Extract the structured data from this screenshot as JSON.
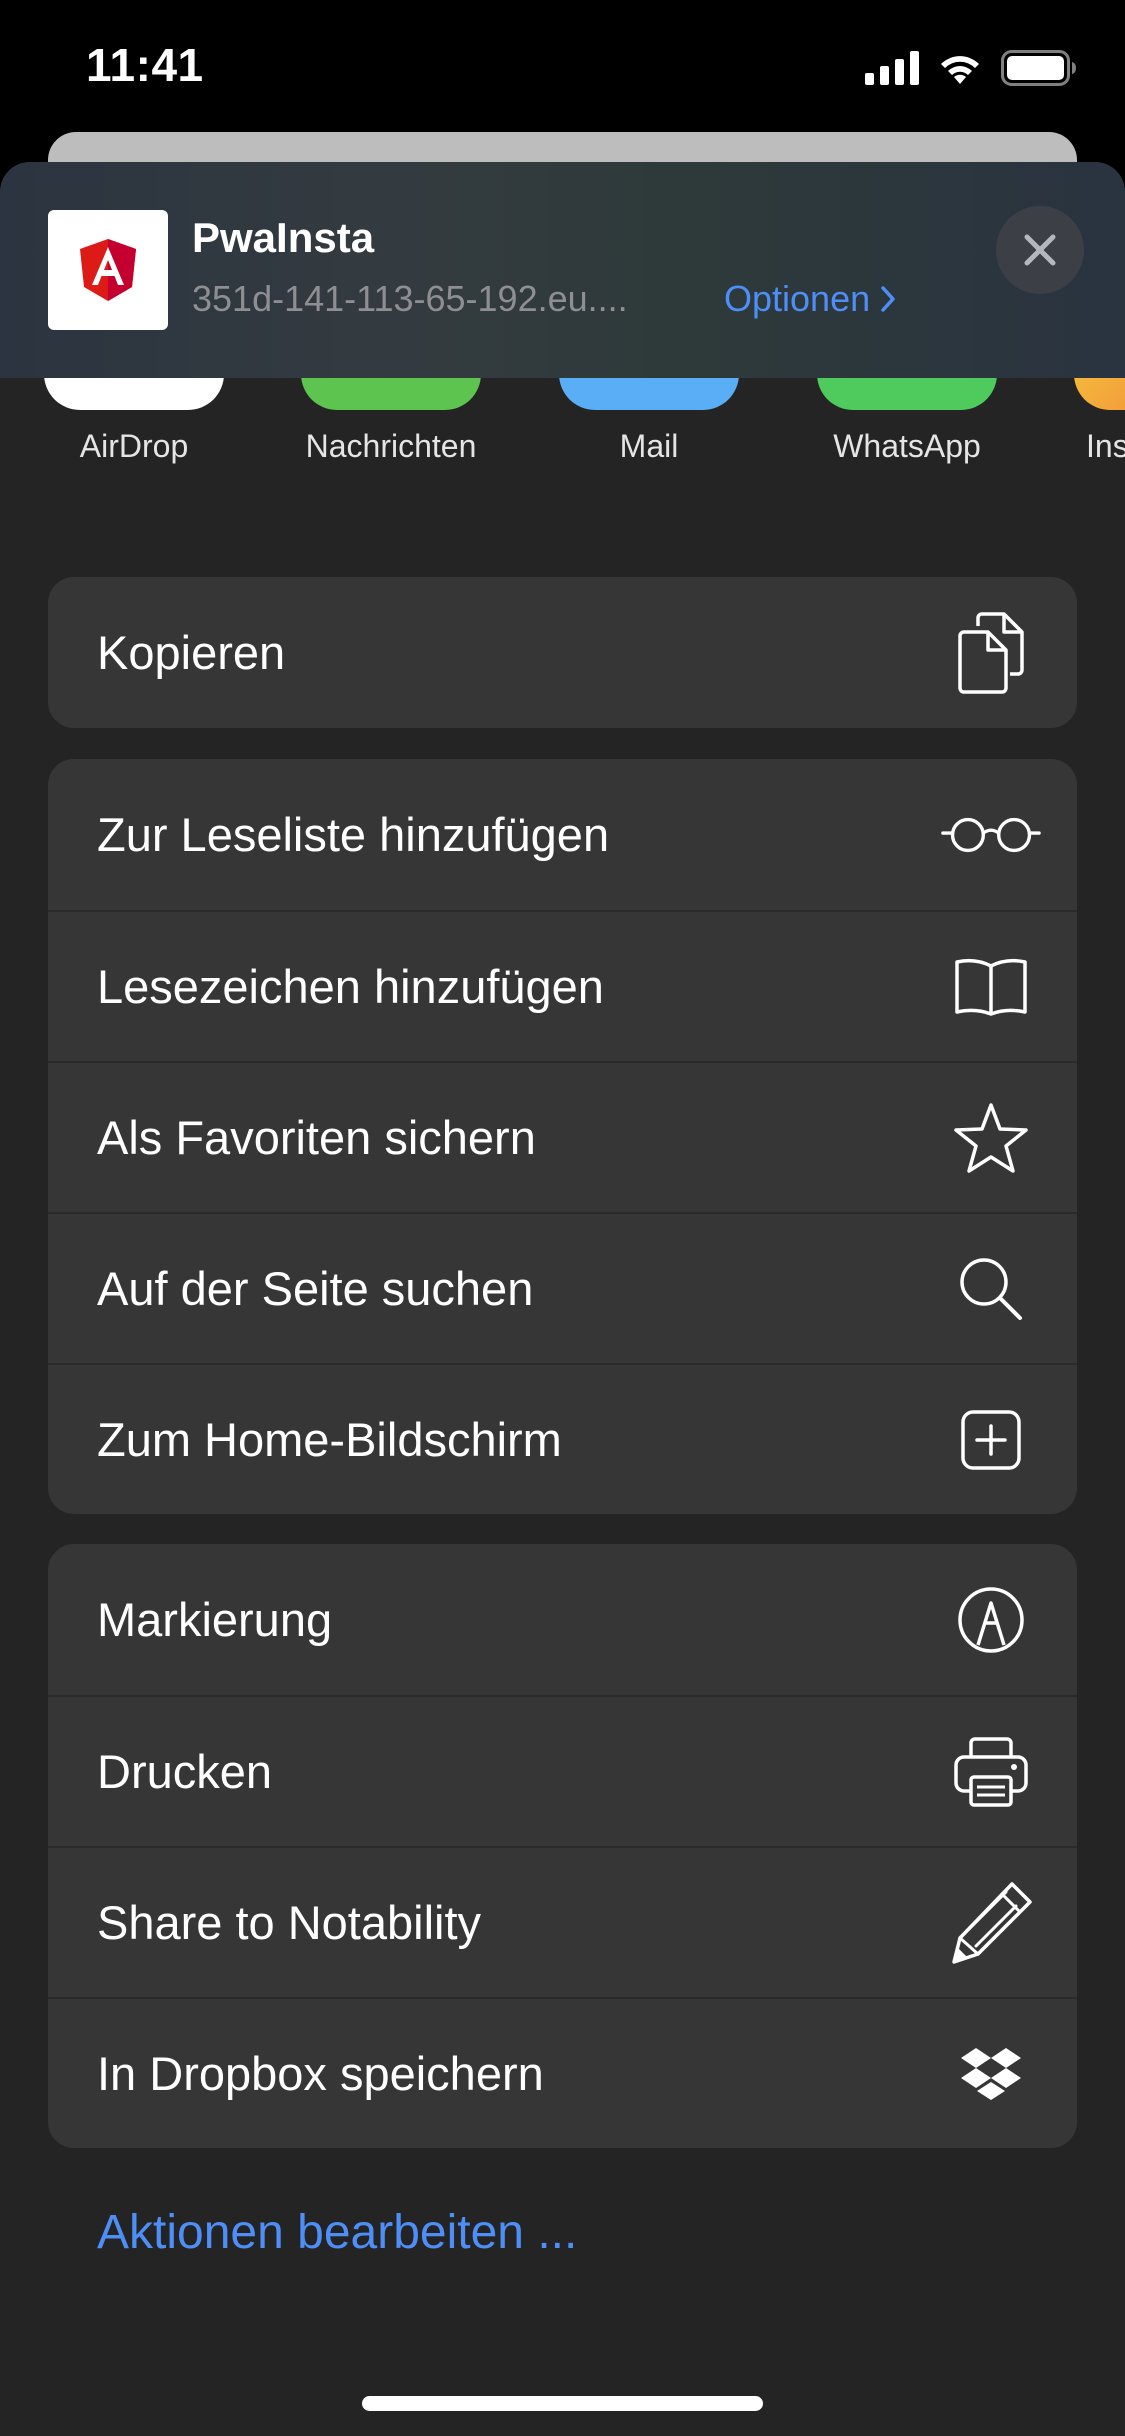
{
  "status_bar": {
    "time": "11:41"
  },
  "share_header": {
    "title": "PwaInsta",
    "url": "351d-141-113-65-192.eu....",
    "options_label": "Optionen",
    "app_icon": "angular-logo"
  },
  "apps": [
    {
      "label": "AirDrop",
      "icon": "airdrop-icon",
      "color": "#ffffff"
    },
    {
      "label": "Nachrichten",
      "icon": "messages-icon",
      "color": "#5dc44f"
    },
    {
      "label": "Mail",
      "icon": "mail-icon",
      "color": "#5aaef5"
    },
    {
      "label": "WhatsApp",
      "icon": "whatsapp-icon",
      "color": "#4ecb5c"
    },
    {
      "label": "Ins",
      "icon": "instagram-icon",
      "color": "#f79a3b"
    }
  ],
  "actions": {
    "copy": {
      "label": "Kopieren",
      "icon": "copy-icon"
    },
    "group2": [
      {
        "label": "Zur Leseliste hinzufügen",
        "icon": "glasses-icon"
      },
      {
        "label": "Lesezeichen hinzufügen",
        "icon": "book-icon"
      },
      {
        "label": "Als Favoriten sichern",
        "icon": "star-icon"
      },
      {
        "label": "Auf der Seite suchen",
        "icon": "search-icon"
      },
      {
        "label": "Zum Home-Bildschirm",
        "icon": "add-square-icon"
      }
    ],
    "group3": [
      {
        "label": "Markierung",
        "icon": "markup-icon"
      },
      {
        "label": "Drucken",
        "icon": "printer-icon"
      },
      {
        "label": "Share to Notability",
        "icon": "pencil-icon"
      },
      {
        "label": "In Dropbox speichern",
        "icon": "dropbox-icon"
      }
    ]
  },
  "edit_actions_label": "Aktionen bearbeiten ...",
  "colors": {
    "accent": "#4d8ef7",
    "sheet_bg": "#242424",
    "cell_bg": "#363636"
  }
}
